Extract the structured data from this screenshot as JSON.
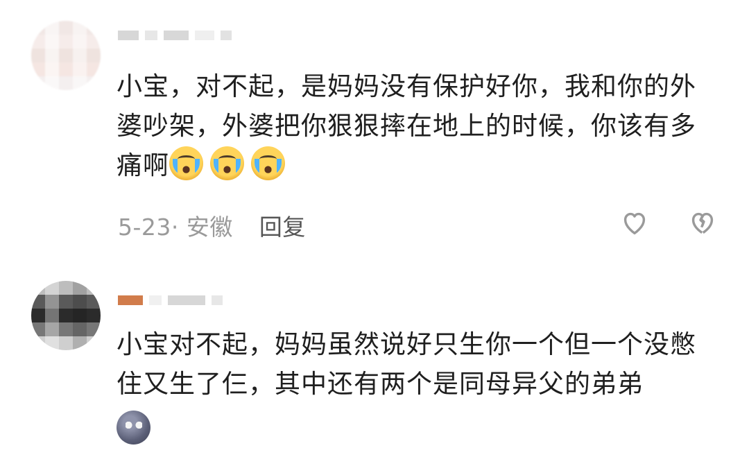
{
  "comments": [
    {
      "text": "小宝，对不起，是妈妈没有保护好你，我和你的外婆吵架，外婆把你狠狠摔在地上的时候，你该有多痛啊",
      "emoji": "crying-face-icon",
      "emoji_count": 3,
      "date": "5-23",
      "location": "安徽",
      "reply_label": "回复",
      "like_icon": "heart-outline-icon",
      "dislike_icon": "broken-heart-icon"
    },
    {
      "text": "小宝对不起，妈妈虽然说好只生你一个但一个没憋住又生了仨，其中还有两个是同母异父的弟弟",
      "emoji": "moon-face-icon"
    }
  ],
  "colors": {
    "text": "#1f1f1f",
    "meta": "#9a9a9a",
    "icon": "#9a9a9a",
    "background": "#ffffff"
  }
}
